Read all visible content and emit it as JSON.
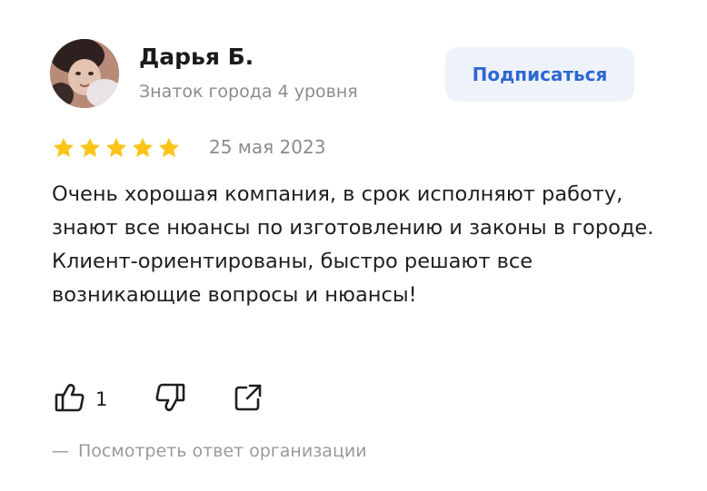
{
  "author": {
    "name": "Дарья Б.",
    "status": "Знаток города 4 уровня",
    "avatar_icon": "user-avatar-photo"
  },
  "subscribe": {
    "label": "Подписаться"
  },
  "review": {
    "rating": 5,
    "rating_max": 5,
    "date": "25 мая 2023",
    "text": "Очень хорошая компания, в срок исполняют работу, знают все нюансы по изготовлению и законы в городе. Клиент-ориентированы, быстро решают все возникающие вопросы и нюансы!"
  },
  "actions": {
    "like_icon": "thumbs-up-icon",
    "like_count": "1",
    "dislike_icon": "thumbs-down-icon",
    "share_icon": "share-icon"
  },
  "org_reply": {
    "dash": "—",
    "label": "Посмотреть ответ организации"
  },
  "colors": {
    "star": "#fcc419",
    "accent": "#2e68d0",
    "button_bg": "#eef3fb",
    "muted_text": "#8c8c8c"
  }
}
